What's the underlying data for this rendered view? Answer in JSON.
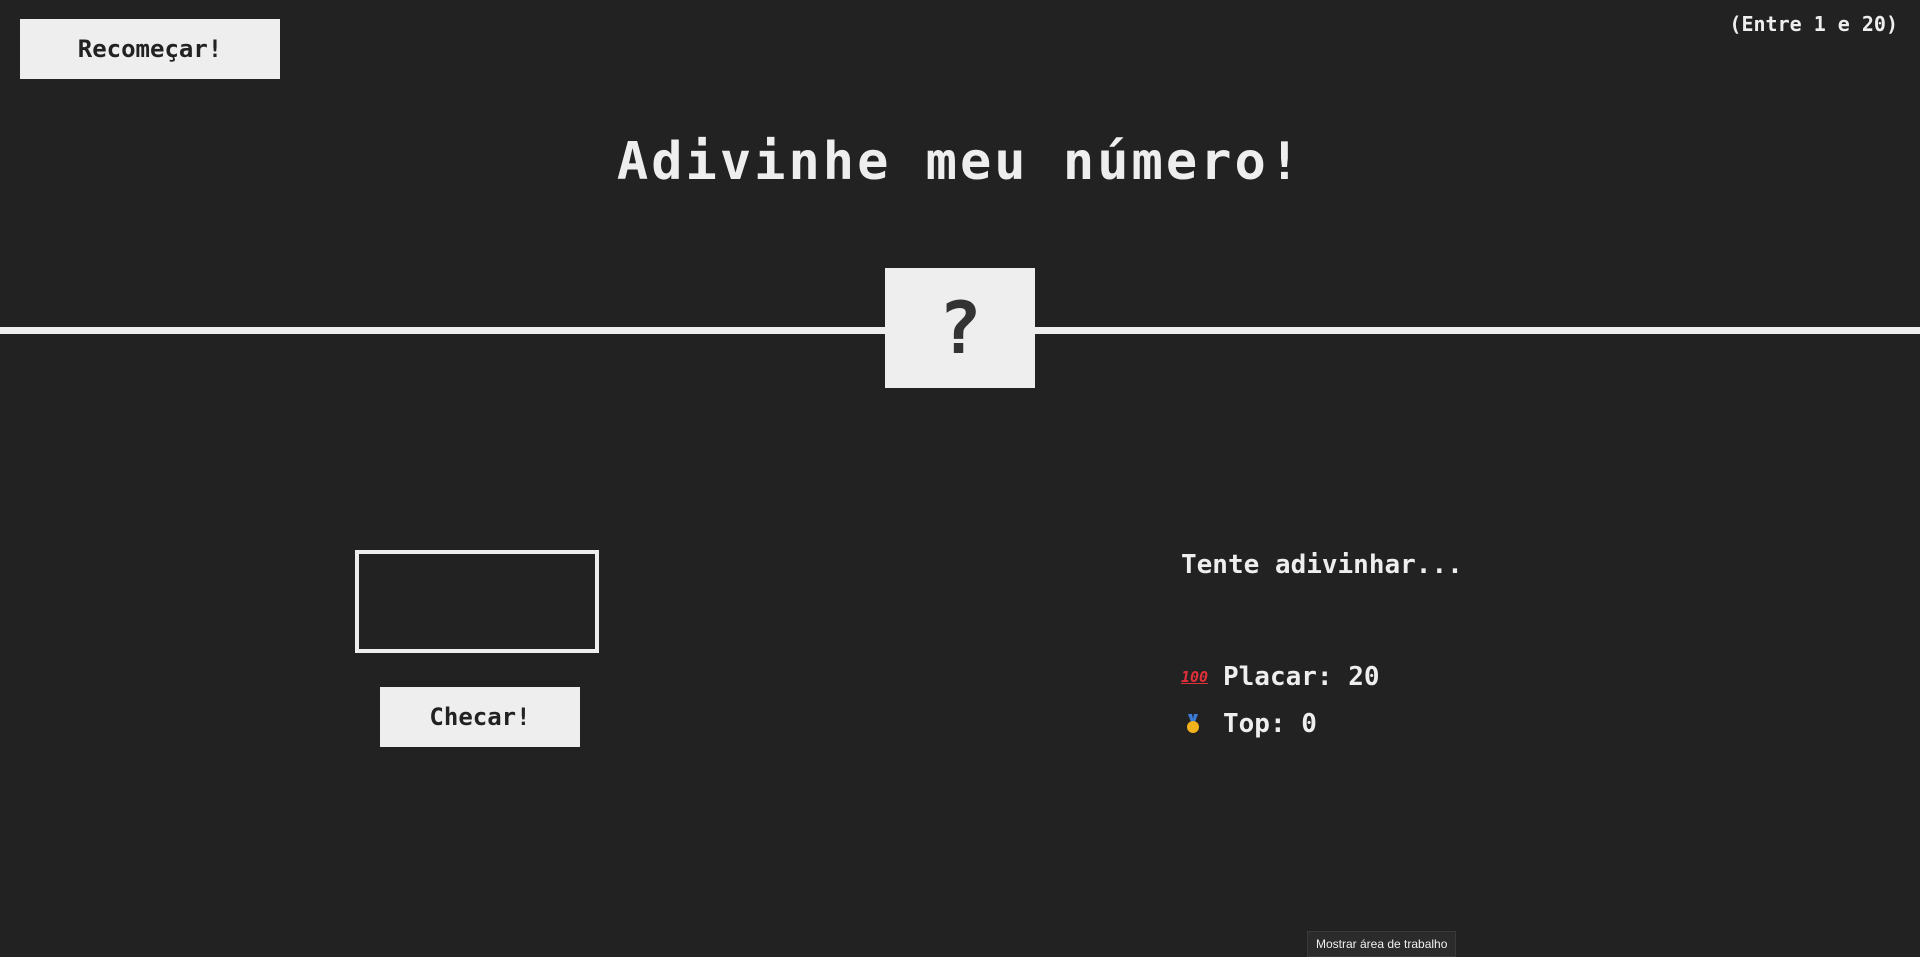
{
  "header": {
    "again_label": "Recomeçar!",
    "between_text": "(Entre 1 e 20)"
  },
  "title": "Adivinhe meu número!",
  "secret_number_display": "?",
  "guess": {
    "value": "",
    "check_label": "Checar!"
  },
  "status": {
    "message": "Tente adivinhar...",
    "score_icon": "hundred-points-icon",
    "score_label": "Placar: ",
    "score_value": "20",
    "highscore_icon": "medal-icon",
    "highscore_label": "Top: ",
    "highscore_value": "0"
  },
  "tooltip": {
    "text": "Mostrar área de trabalho"
  },
  "colors": {
    "background": "#222222",
    "foreground": "#eeeeee",
    "button_text": "#222222"
  }
}
